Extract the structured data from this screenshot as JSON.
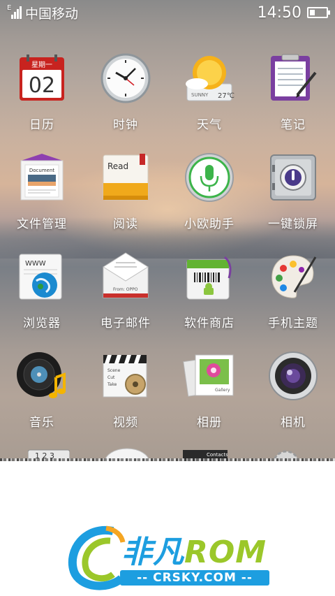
{
  "status_bar": {
    "carrier": "中国移动",
    "network_type": "E",
    "time": "14:50",
    "battery_level": 0.3,
    "icons": [
      "signal-icon",
      "battery-icon"
    ]
  },
  "apps": [
    {
      "label": "日历",
      "icon": "calendar-icon",
      "calendar": {
        "weekday": "星期一",
        "day": "02"
      }
    },
    {
      "label": "时钟",
      "icon": "clock-icon"
    },
    {
      "label": "天气",
      "icon": "weather-icon",
      "weather": {
        "condition": "SUNNY",
        "temp": "27℃"
      }
    },
    {
      "label": "笔记",
      "icon": "notepad-icon"
    },
    {
      "label": "文件管理",
      "icon": "file-manager-icon",
      "doc_text": "Document"
    },
    {
      "label": "阅读",
      "icon": "reader-icon",
      "book_text": "Read"
    },
    {
      "label": "小欧助手",
      "icon": "voice-assistant-icon"
    },
    {
      "label": "一键锁屏",
      "icon": "safe-lock-icon"
    },
    {
      "label": "浏览器",
      "icon": "browser-icon",
      "page_text": "WWW"
    },
    {
      "label": "电子邮件",
      "icon": "email-icon",
      "envelope_text": "From: OPPO"
    },
    {
      "label": "软件商店",
      "icon": "app-store-icon"
    },
    {
      "label": "手机主题",
      "icon": "theme-palette-icon"
    },
    {
      "label": "音乐",
      "icon": "music-icon"
    },
    {
      "label": "视频",
      "icon": "video-icon",
      "clapper_lines": [
        "Scene",
        "Cut",
        "Take"
      ]
    },
    {
      "label": "相册",
      "icon": "gallery-icon",
      "photo_text": "Gallery"
    },
    {
      "label": "相机",
      "icon": "camera-icon"
    }
  ],
  "partial_row": {
    "items": [
      {
        "icon": "calculator-icon",
        "text": "1 2 3"
      },
      {
        "icon": "compass-icon"
      },
      {
        "icon": "contacts-icon",
        "text": "Contacts"
      },
      {
        "icon": "settings-gear-icon"
      }
    ]
  },
  "watermark": {
    "brand_cn": "非凡",
    "brand_en": "ROM",
    "site": "-- CRSKY.COM --",
    "colors": {
      "blue": "#1d9ee0",
      "green": "#9bc72a"
    }
  }
}
